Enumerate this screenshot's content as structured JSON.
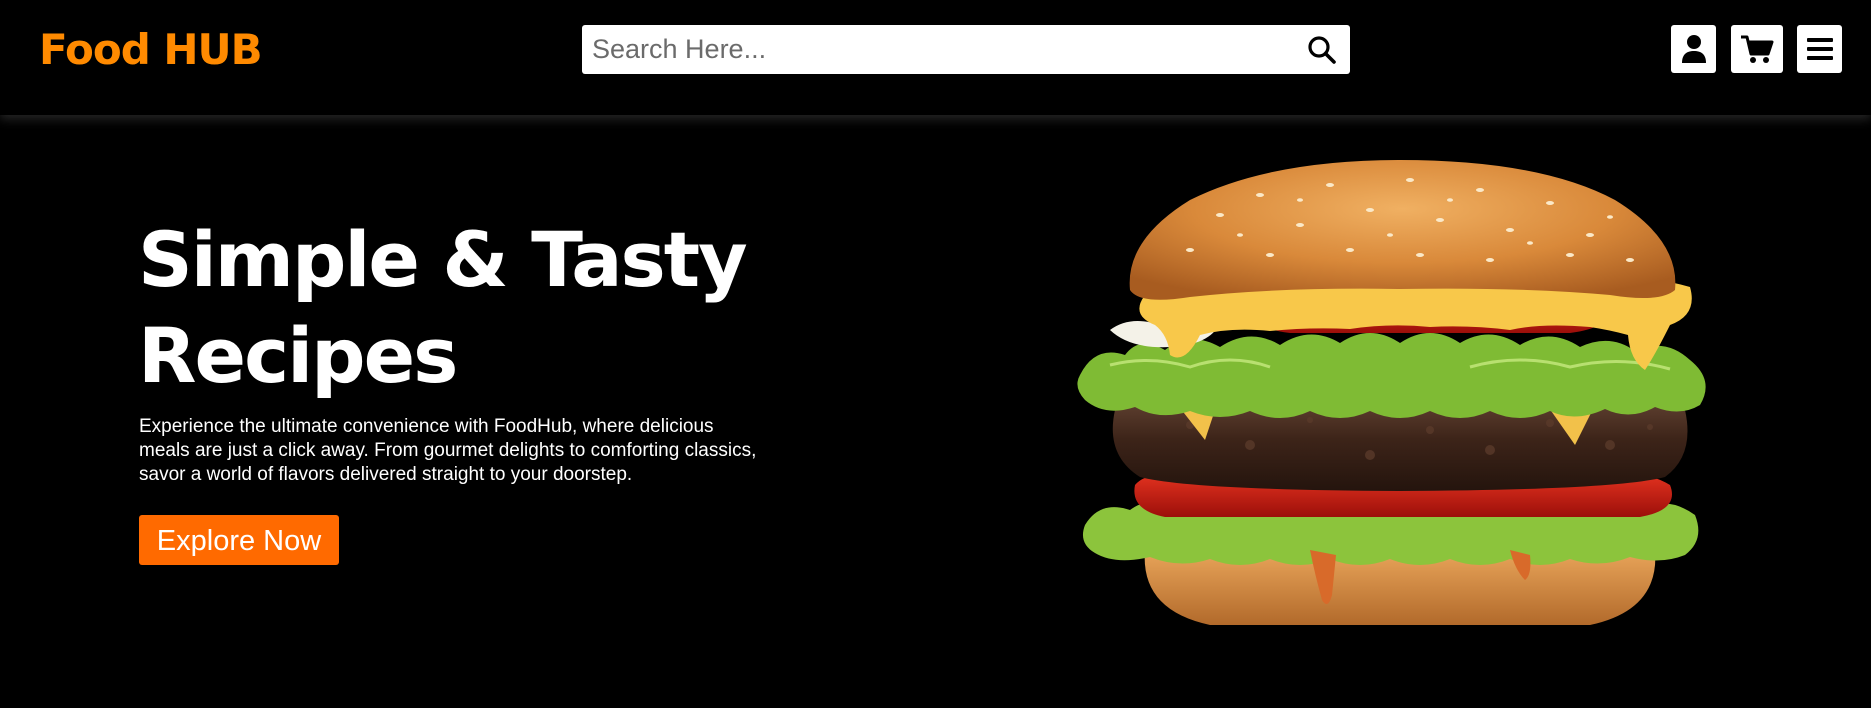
{
  "header": {
    "logo": "Food HUB",
    "search": {
      "placeholder": "Search Here...",
      "value": ""
    },
    "icons": [
      "search-icon",
      "user-icon",
      "cart-icon",
      "menu-icon"
    ]
  },
  "hero": {
    "title": "Simple & Tasty Recipes",
    "description": "Experience the ultimate convenience with FoodHub, where delicious meals are just a click away. From gourmet delights to comforting classics, savor a world of flavors delivered straight to your doorstep.",
    "cta_label": "Explore Now",
    "image": "burger"
  },
  "colors": {
    "background": "#000000",
    "logo": "#ff8a00",
    "button": "#ff6a00",
    "text": "#ffffff"
  }
}
